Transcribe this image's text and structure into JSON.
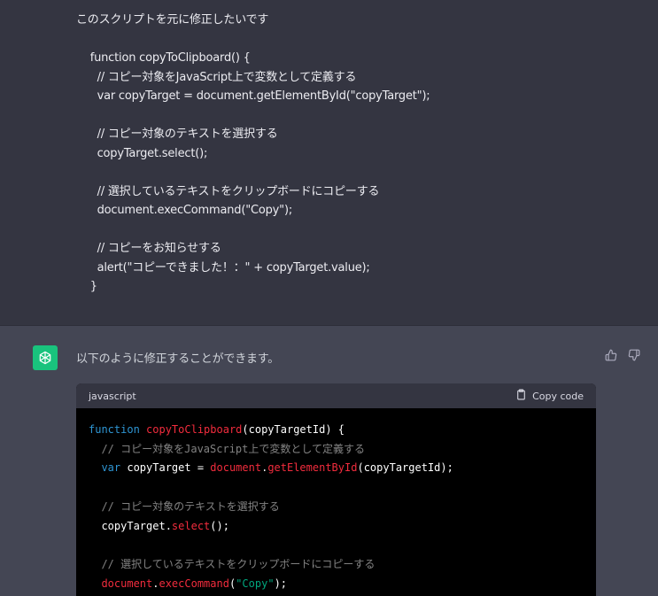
{
  "user_message": {
    "lines": [
      "このスクリプトを元に修正したいです",
      "",
      "    function copyToClipboard() {",
      "      // コピー対象をJavaScript上で変数として定義する",
      "      var copyTarget = document.getElementById(\"copyTarget\");",
      "",
      "      // コピー対象のテキストを選択する",
      "      copyTarget.select();",
      "",
      "      // 選択しているテキストをクリップボードにコピーする",
      "      document.execCommand(\"Copy\");",
      "",
      "      // コピーをお知らせする",
      "      alert(\"コピーできました！：\" + copyTarget.value);",
      "    }"
    ]
  },
  "assistant_message": {
    "avatar_icon": "openai-logo-icon",
    "text": "以下のように修正することができます。",
    "feedback": {
      "thumb_up_icon": "thumbs-up-icon",
      "thumb_down_icon": "thumbs-down-icon"
    },
    "code_block": {
      "language": "javascript",
      "copy_label": "Copy code",
      "copy_icon": "clipboard-icon",
      "lines": [
        [
          {
            "t": "kw",
            "v": "function "
          },
          {
            "t": "fn",
            "v": "copyToClipboard"
          },
          {
            "t": "pl",
            "v": "(copyTargetId) {"
          }
        ],
        [
          {
            "t": "cm",
            "v": "  // コピー対象をJavaScript上で変数として定義する"
          }
        ],
        [
          {
            "t": "kw",
            "v": "  var "
          },
          {
            "t": "pl",
            "v": "copyTarget = "
          },
          {
            "t": "fn",
            "v": "document"
          },
          {
            "t": "pl",
            "v": "."
          },
          {
            "t": "fn",
            "v": "getElementById"
          },
          {
            "t": "pl",
            "v": "(copyTargetId);"
          }
        ],
        [],
        [
          {
            "t": "cm",
            "v": "  // コピー対象のテキストを選択する"
          }
        ],
        [
          {
            "t": "pl",
            "v": "  copyTarget."
          },
          {
            "t": "fn",
            "v": "select"
          },
          {
            "t": "pl",
            "v": "();"
          }
        ],
        [],
        [
          {
            "t": "cm",
            "v": "  // 選択しているテキストをクリップボードにコピーする"
          }
        ],
        [
          {
            "t": "fn",
            "v": "  document"
          },
          {
            "t": "pl",
            "v": "."
          },
          {
            "t": "fn",
            "v": "execCommand"
          },
          {
            "t": "pl",
            "v": "("
          },
          {
            "t": "str",
            "v": "\"Copy\""
          },
          {
            "t": "pl",
            "v": ");"
          }
        ]
      ]
    }
  },
  "colors": {
    "user_bg": "#343541",
    "assistant_bg": "#444654",
    "avatar_bg": "#19c37d",
    "code_bg": "#000000",
    "keyword": "#2e95d3",
    "function": "#f22c3d",
    "string": "#00a67d"
  }
}
